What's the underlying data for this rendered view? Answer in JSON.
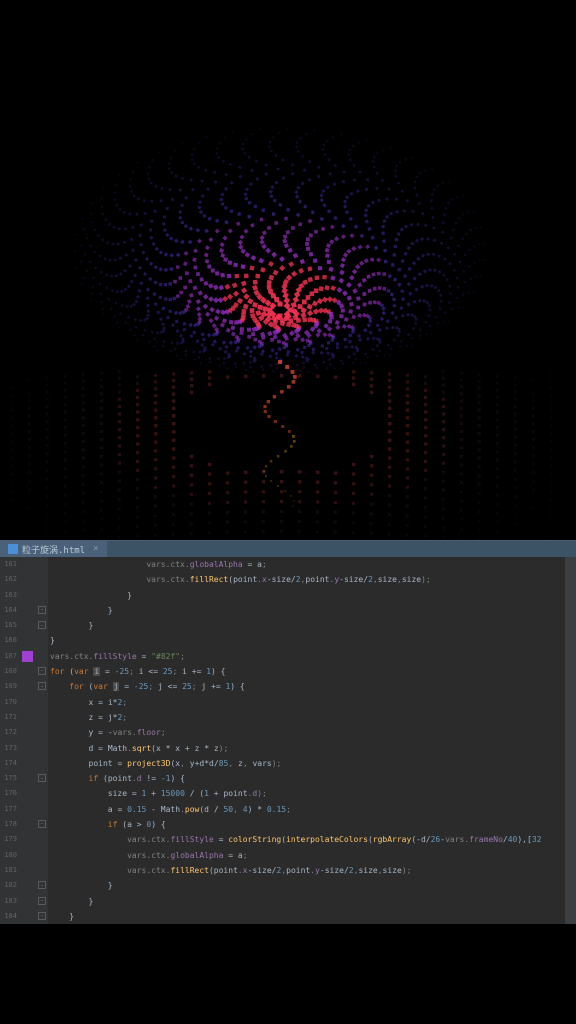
{
  "tab": {
    "filename": "粒子旋涡.html",
    "close_icon": "×"
  },
  "gutter": {
    "start": 160,
    "lines": [
      "161",
      "162",
      "163",
      "164",
      "165",
      "166",
      "167",
      "168",
      "169",
      "170",
      "171",
      "172",
      "173",
      "174",
      "175",
      "176",
      "177",
      "178",
      "179",
      "180",
      "181",
      "182",
      "183",
      "184"
    ]
  },
  "code": {
    "lines": [
      {
        "indent": 20,
        "tokens": [
          {
            "t": "vars",
            "c": "gray"
          },
          {
            "t": ".",
            "c": "gray"
          },
          {
            "t": "ctx",
            "c": "gray"
          },
          {
            "t": ".",
            "c": "gray"
          },
          {
            "t": "globalAlpha",
            "c": "prop"
          },
          {
            "t": " = ",
            "c": "ident"
          },
          {
            "t": "a",
            "c": "ident"
          },
          {
            "t": ";",
            "c": "gray"
          }
        ]
      },
      {
        "indent": 20,
        "tokens": [
          {
            "t": "vars",
            "c": "gray"
          },
          {
            "t": ".",
            "c": "gray"
          },
          {
            "t": "ctx",
            "c": "gray"
          },
          {
            "t": ".",
            "c": "gray"
          },
          {
            "t": "fillRect",
            "c": "fn"
          },
          {
            "t": "(",
            "c": "ident"
          },
          {
            "t": "point",
            "c": "ident"
          },
          {
            "t": ".",
            "c": "gray"
          },
          {
            "t": "x",
            "c": "prop"
          },
          {
            "t": "-",
            "c": "ident"
          },
          {
            "t": "size",
            "c": "ident"
          },
          {
            "t": "/",
            "c": "ident"
          },
          {
            "t": "2",
            "c": "num"
          },
          {
            "t": ",",
            "c": "gray"
          },
          {
            "t": "point",
            "c": "ident"
          },
          {
            "t": ".",
            "c": "gray"
          },
          {
            "t": "y",
            "c": "prop"
          },
          {
            "t": "-",
            "c": "ident"
          },
          {
            "t": "size",
            "c": "ident"
          },
          {
            "t": "/",
            "c": "ident"
          },
          {
            "t": "2",
            "c": "num"
          },
          {
            "t": ",",
            "c": "gray"
          },
          {
            "t": "size",
            "c": "ident"
          },
          {
            "t": ",",
            "c": "gray"
          },
          {
            "t": "size",
            "c": "ident"
          },
          {
            "t": ");",
            "c": "gray"
          }
        ]
      },
      {
        "indent": 16,
        "tokens": [
          {
            "t": "}",
            "c": "ident"
          }
        ]
      },
      {
        "indent": 12,
        "tokens": [
          {
            "t": "}",
            "c": "ident"
          }
        ]
      },
      {
        "indent": 8,
        "tokens": [
          {
            "t": "}",
            "c": "ident"
          }
        ]
      },
      {
        "indent": 0,
        "tokens": [
          {
            "t": "}",
            "c": "ident"
          }
        ]
      },
      {
        "indent": 0,
        "tokens": [
          {
            "t": "vars",
            "c": "gray"
          },
          {
            "t": ".",
            "c": "gray"
          },
          {
            "t": "ctx",
            "c": "gray"
          },
          {
            "t": ".",
            "c": "gray"
          },
          {
            "t": "fillStyle",
            "c": "prop"
          },
          {
            "t": " = ",
            "c": "ident"
          },
          {
            "t": "\"#82f\"",
            "c": "str"
          },
          {
            "t": ";",
            "c": "gray"
          }
        ]
      },
      {
        "indent": 0,
        "tokens": [
          {
            "t": "for",
            "c": "kw"
          },
          {
            "t": " (",
            "c": "ident"
          },
          {
            "t": "var ",
            "c": "kw"
          },
          {
            "t": "i",
            "c": "cursor-mark"
          },
          {
            "t": " = ",
            "c": "ident"
          },
          {
            "t": "-25",
            "c": "num"
          },
          {
            "t": "; ",
            "c": "gray"
          },
          {
            "t": "i",
            "c": "ident"
          },
          {
            "t": " <= ",
            "c": "ident"
          },
          {
            "t": "25",
            "c": "num"
          },
          {
            "t": "; ",
            "c": "gray"
          },
          {
            "t": "i",
            "c": "ident"
          },
          {
            "t": " += ",
            "c": "ident"
          },
          {
            "t": "1",
            "c": "num"
          },
          {
            "t": ") {",
            "c": "ident"
          }
        ]
      },
      {
        "indent": 4,
        "tokens": [
          {
            "t": "for",
            "c": "kw"
          },
          {
            "t": " (",
            "c": "ident"
          },
          {
            "t": "var ",
            "c": "kw"
          },
          {
            "t": "j",
            "c": "cursor-mark"
          },
          {
            "t": " = ",
            "c": "ident"
          },
          {
            "t": "-25",
            "c": "num"
          },
          {
            "t": "; ",
            "c": "gray"
          },
          {
            "t": "j",
            "c": "ident"
          },
          {
            "t": " <= ",
            "c": "ident"
          },
          {
            "t": "25",
            "c": "num"
          },
          {
            "t": "; ",
            "c": "gray"
          },
          {
            "t": "j",
            "c": "ident"
          },
          {
            "t": " += ",
            "c": "ident"
          },
          {
            "t": "1",
            "c": "num"
          },
          {
            "t": ") {",
            "c": "ident"
          }
        ]
      },
      {
        "indent": 8,
        "tokens": [
          {
            "t": "x",
            "c": "ident"
          },
          {
            "t": " = ",
            "c": "ident"
          },
          {
            "t": "i",
            "c": "ident"
          },
          {
            "t": "*",
            "c": "ident"
          },
          {
            "t": "2",
            "c": "num"
          },
          {
            "t": ";",
            "c": "gray"
          }
        ]
      },
      {
        "indent": 8,
        "tokens": [
          {
            "t": "z",
            "c": "ident"
          },
          {
            "t": " = ",
            "c": "ident"
          },
          {
            "t": "j",
            "c": "ident"
          },
          {
            "t": "*",
            "c": "ident"
          },
          {
            "t": "2",
            "c": "num"
          },
          {
            "t": ";",
            "c": "gray"
          }
        ]
      },
      {
        "indent": 8,
        "tokens": [
          {
            "t": "y",
            "c": "ident"
          },
          {
            "t": " = ",
            "c": "ident"
          },
          {
            "t": "-",
            "c": "ident"
          },
          {
            "t": "vars",
            "c": "gray"
          },
          {
            "t": ".",
            "c": "gray"
          },
          {
            "t": "floor",
            "c": "prop"
          },
          {
            "t": ";",
            "c": "gray"
          }
        ]
      },
      {
        "indent": 8,
        "tokens": [
          {
            "t": "d",
            "c": "ident"
          },
          {
            "t": " = ",
            "c": "ident"
          },
          {
            "t": "Math",
            "c": "ident"
          },
          {
            "t": ".",
            "c": "gray"
          },
          {
            "t": "sqrt",
            "c": "fn"
          },
          {
            "t": "(",
            "c": "ident"
          },
          {
            "t": "x",
            "c": "ident"
          },
          {
            "t": " * ",
            "c": "ident"
          },
          {
            "t": "x",
            "c": "ident"
          },
          {
            "t": " + ",
            "c": "ident"
          },
          {
            "t": "z",
            "c": "ident"
          },
          {
            "t": " * ",
            "c": "ident"
          },
          {
            "t": "z",
            "c": "ident"
          },
          {
            "t": ");",
            "c": "gray"
          }
        ]
      },
      {
        "indent": 8,
        "tokens": [
          {
            "t": "point",
            "c": "ident"
          },
          {
            "t": " = ",
            "c": "ident"
          },
          {
            "t": "project3D",
            "c": "fn"
          },
          {
            "t": "(",
            "c": "ident"
          },
          {
            "t": "x",
            "c": "ident"
          },
          {
            "t": ", ",
            "c": "gray"
          },
          {
            "t": "y",
            "c": "ident"
          },
          {
            "t": "+",
            "c": "ident"
          },
          {
            "t": "d",
            "c": "ident"
          },
          {
            "t": "*",
            "c": "ident"
          },
          {
            "t": "d",
            "c": "ident"
          },
          {
            "t": "/",
            "c": "ident"
          },
          {
            "t": "85",
            "c": "num"
          },
          {
            "t": ", ",
            "c": "gray"
          },
          {
            "t": "z",
            "c": "ident"
          },
          {
            "t": ", ",
            "c": "gray"
          },
          {
            "t": "vars",
            "c": "ident"
          },
          {
            "t": ");",
            "c": "gray"
          }
        ]
      },
      {
        "indent": 8,
        "tokens": [
          {
            "t": "if",
            "c": "kw"
          },
          {
            "t": " (",
            "c": "ident"
          },
          {
            "t": "point",
            "c": "ident"
          },
          {
            "t": ".",
            "c": "gray"
          },
          {
            "t": "d",
            "c": "prop"
          },
          {
            "t": " != ",
            "c": "ident"
          },
          {
            "t": "-1",
            "c": "num"
          },
          {
            "t": ") {",
            "c": "ident"
          }
        ]
      },
      {
        "indent": 12,
        "tokens": [
          {
            "t": "size",
            "c": "ident"
          },
          {
            "t": " = ",
            "c": "ident"
          },
          {
            "t": "1",
            "c": "num"
          },
          {
            "t": " + ",
            "c": "ident"
          },
          {
            "t": "15000",
            "c": "num"
          },
          {
            "t": " / (",
            "c": "ident"
          },
          {
            "t": "1",
            "c": "num"
          },
          {
            "t": " + ",
            "c": "ident"
          },
          {
            "t": "point",
            "c": "ident"
          },
          {
            "t": ".",
            "c": "gray"
          },
          {
            "t": "d",
            "c": "prop"
          },
          {
            "t": ");",
            "c": "gray"
          }
        ]
      },
      {
        "indent": 12,
        "tokens": [
          {
            "t": "a",
            "c": "ident"
          },
          {
            "t": " = ",
            "c": "ident"
          },
          {
            "t": "0.15",
            "c": "num"
          },
          {
            "t": " - ",
            "c": "ident"
          },
          {
            "t": "Math",
            "c": "ident"
          },
          {
            "t": ".",
            "c": "gray"
          },
          {
            "t": "pow",
            "c": "fn"
          },
          {
            "t": "(",
            "c": "ident"
          },
          {
            "t": "d",
            "c": "ident"
          },
          {
            "t": " / ",
            "c": "ident"
          },
          {
            "t": "50",
            "c": "num"
          },
          {
            "t": ", ",
            "c": "gray"
          },
          {
            "t": "4",
            "c": "num"
          },
          {
            "t": ") * ",
            "c": "ident"
          },
          {
            "t": "0.15",
            "c": "num"
          },
          {
            "t": ";",
            "c": "gray"
          }
        ]
      },
      {
        "indent": 12,
        "tokens": [
          {
            "t": "if",
            "c": "kw"
          },
          {
            "t": " (",
            "c": "ident"
          },
          {
            "t": "a",
            "c": "ident"
          },
          {
            "t": " > ",
            "c": "ident"
          },
          {
            "t": "0",
            "c": "num"
          },
          {
            "t": ") {",
            "c": "ident"
          }
        ]
      },
      {
        "indent": 16,
        "tokens": [
          {
            "t": "vars",
            "c": "gray"
          },
          {
            "t": ".",
            "c": "gray"
          },
          {
            "t": "ctx",
            "c": "gray"
          },
          {
            "t": ".",
            "c": "gray"
          },
          {
            "t": "fillStyle",
            "c": "prop"
          },
          {
            "t": " = ",
            "c": "ident"
          },
          {
            "t": "colorString",
            "c": "fn"
          },
          {
            "t": "(",
            "c": "ident"
          },
          {
            "t": "interpolateColors",
            "c": "fn"
          },
          {
            "t": "(",
            "c": "ident"
          },
          {
            "t": "rgbArray",
            "c": "fn"
          },
          {
            "t": "(",
            "c": "ident"
          },
          {
            "t": "-d",
            "c": "ident"
          },
          {
            "t": "/",
            "c": "ident"
          },
          {
            "t": "26",
            "c": "num"
          },
          {
            "t": "-",
            "c": "ident"
          },
          {
            "t": "vars",
            "c": "gray"
          },
          {
            "t": ".",
            "c": "gray"
          },
          {
            "t": "frameNo",
            "c": "prop"
          },
          {
            "t": "/",
            "c": "ident"
          },
          {
            "t": "40",
            "c": "num"
          },
          {
            "t": "),[",
            "c": "ident"
          },
          {
            "t": "32",
            "c": "num"
          }
        ]
      },
      {
        "indent": 16,
        "tokens": [
          {
            "t": "vars",
            "c": "gray"
          },
          {
            "t": ".",
            "c": "gray"
          },
          {
            "t": "ctx",
            "c": "gray"
          },
          {
            "t": ".",
            "c": "gray"
          },
          {
            "t": "globalAlpha",
            "c": "prop"
          },
          {
            "t": " = ",
            "c": "ident"
          },
          {
            "t": "a",
            "c": "ident"
          },
          {
            "t": ";",
            "c": "gray"
          }
        ]
      },
      {
        "indent": 16,
        "tokens": [
          {
            "t": "vars",
            "c": "gray"
          },
          {
            "t": ".",
            "c": "gray"
          },
          {
            "t": "ctx",
            "c": "gray"
          },
          {
            "t": ".",
            "c": "gray"
          },
          {
            "t": "fillRect",
            "c": "fn"
          },
          {
            "t": "(",
            "c": "ident"
          },
          {
            "t": "point",
            "c": "ident"
          },
          {
            "t": ".",
            "c": "gray"
          },
          {
            "t": "x",
            "c": "prop"
          },
          {
            "t": "-",
            "c": "ident"
          },
          {
            "t": "size",
            "c": "ident"
          },
          {
            "t": "/",
            "c": "ident"
          },
          {
            "t": "2",
            "c": "num"
          },
          {
            "t": ",",
            "c": "gray"
          },
          {
            "t": "point",
            "c": "ident"
          },
          {
            "t": ".",
            "c": "gray"
          },
          {
            "t": "y",
            "c": "prop"
          },
          {
            "t": "-",
            "c": "ident"
          },
          {
            "t": "size",
            "c": "ident"
          },
          {
            "t": "/",
            "c": "ident"
          },
          {
            "t": "2",
            "c": "num"
          },
          {
            "t": ",",
            "c": "gray"
          },
          {
            "t": "size",
            "c": "ident"
          },
          {
            "t": ",",
            "c": "gray"
          },
          {
            "t": "size",
            "c": "ident"
          },
          {
            "t": ");",
            "c": "gray"
          }
        ]
      },
      {
        "indent": 12,
        "tokens": [
          {
            "t": "}",
            "c": "ident"
          }
        ]
      },
      {
        "indent": 8,
        "tokens": [
          {
            "t": "}",
            "c": "ident"
          }
        ]
      },
      {
        "indent": 4,
        "tokens": [
          {
            "t": "}",
            "c": "ident"
          }
        ]
      }
    ]
  },
  "fold_markers": [
    3,
    4,
    7,
    8,
    14,
    17,
    21,
    22,
    23
  ],
  "bookmark_line": 6
}
